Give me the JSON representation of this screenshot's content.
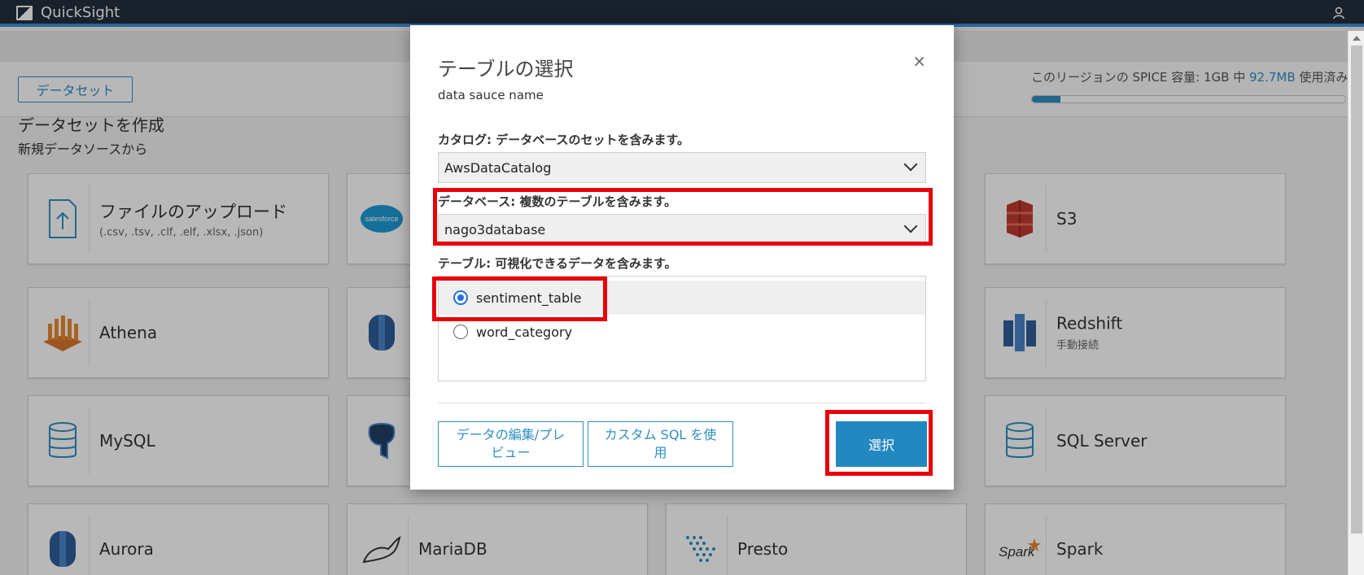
{
  "app": {
    "title": "QuickSight"
  },
  "header": {
    "dataset_button": "データセット"
  },
  "spice": {
    "prefix": "このリージョンの SPICE 容量: 1GB 中 ",
    "used": "92.7MB",
    "suffix": " 使用済み",
    "used_fraction": 0.09
  },
  "create": {
    "title": "データセットを作成",
    "subtitle": "新規データソースから"
  },
  "tiles": {
    "upload": {
      "label": "ファイルのアップロード",
      "sublabel": "(.csv, .tsv, .clf, .elf, .xlsx, .json)"
    },
    "s3": {
      "label": "S3"
    },
    "athena": {
      "label": "Athena"
    },
    "redshift": {
      "label": "Redshift",
      "sublabel": "手動接続"
    },
    "mysql": {
      "label": "MySQL"
    },
    "sqlserver": {
      "label": "SQL Server"
    },
    "aurora": {
      "label": "Aurora"
    },
    "mariadb": {
      "label": "MariaDB"
    },
    "presto": {
      "label": "Presto"
    },
    "spark": {
      "label": "Spark"
    },
    "salesforce_icon_text": "salesforce",
    "spark_icon_text": "Spark"
  },
  "modal": {
    "title": "テーブルの選択",
    "close": "×",
    "source_name": "data sauce name",
    "catalog_label": "カタログ: データベースのセットを含みます。",
    "catalog_value": "AwsDataCatalog",
    "database_label": "データベース: 複数のテーブルを含みます。",
    "database_value": "nago3database",
    "table_label": "テーブル: 可視化できるデータを含みます。",
    "tables": [
      {
        "name": "sentiment_table",
        "selected": true
      },
      {
        "name": "word_category",
        "selected": false
      }
    ],
    "edit_button": "データの編集/プレビュー",
    "custom_sql_button": "カスタム SQL を使用",
    "select_button": "選択"
  },
  "colors": {
    "accent": "#2f8fc3",
    "primary": "#2387c0",
    "highlight": "#e8000b",
    "topbar": "#232f3e"
  }
}
